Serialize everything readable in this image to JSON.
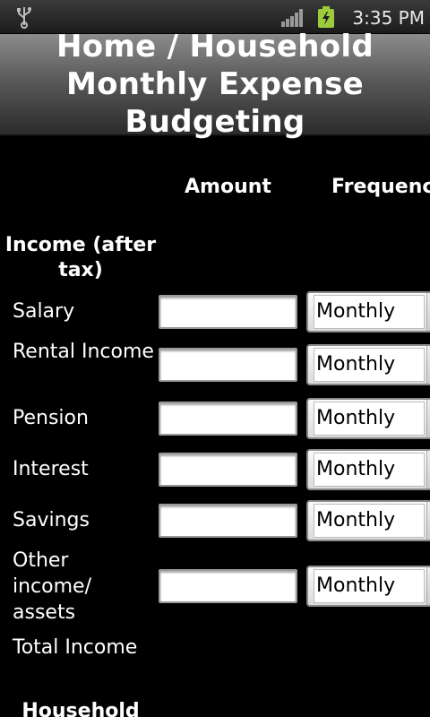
{
  "status_bar": {
    "time": "3:35 PM",
    "icons": [
      "usb-icon",
      "signal-icon",
      "battery-charging-icon"
    ]
  },
  "title": "Home / Household Monthly Expense Budgeting",
  "columns": {
    "amount": "Amount",
    "frequency": "Frequency"
  },
  "income": {
    "heading": "Income (after tax)",
    "rows": [
      {
        "label": "Salary",
        "amount": "",
        "frequency": "Monthly"
      },
      {
        "label": "Rental Income",
        "amount": "",
        "frequency": "Monthly"
      },
      {
        "label": "Pension",
        "amount": "",
        "frequency": "Monthly"
      },
      {
        "label": "Interest",
        "amount": "",
        "frequency": "Monthly"
      },
      {
        "label": "Savings",
        "amount": "",
        "frequency": "Monthly"
      },
      {
        "label": "Other income/ assets",
        "amount": "",
        "frequency": "Monthly"
      }
    ],
    "total_label": "Total Income"
  },
  "household": {
    "heading": "Household"
  }
}
